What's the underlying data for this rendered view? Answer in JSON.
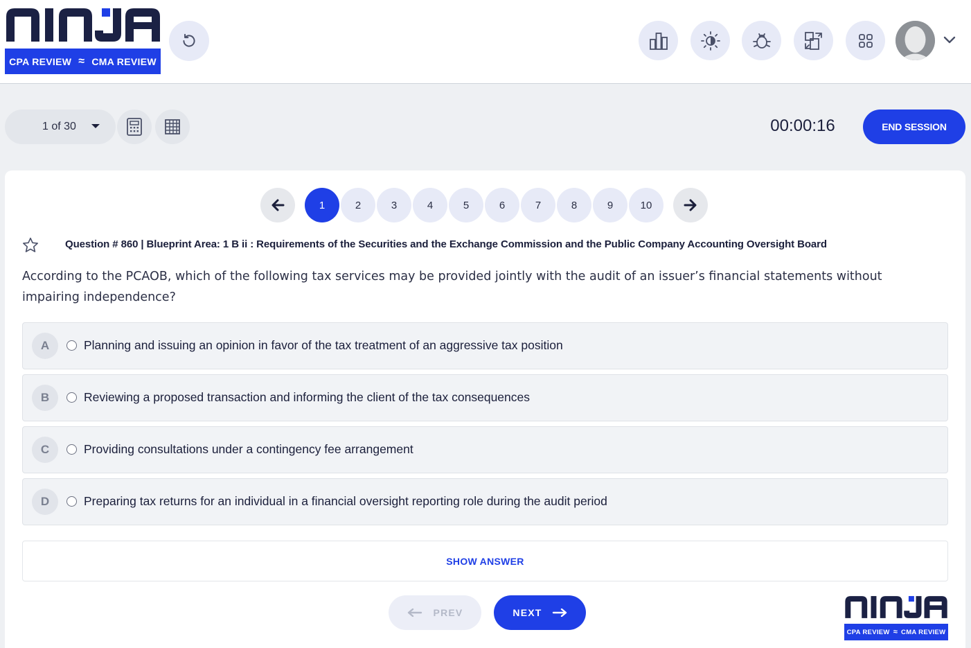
{
  "brand": {
    "logo_text": "NINJA",
    "banner_left": "CPA REVIEW",
    "banner_sep": "≈",
    "banner_right": "CMA REVIEW",
    "accent_color": "#1f3fe6",
    "dark_color": "#1b2144"
  },
  "header": {
    "icons": [
      "refresh-icon",
      "bar-chart-icon",
      "brightness-icon",
      "bug-icon",
      "switch-icon",
      "grid-icon",
      "avatar",
      "chevron-down-icon"
    ]
  },
  "toolbar": {
    "question_select": "1 of 30",
    "timer": "00:00:16",
    "end_session": "END SESSION"
  },
  "pager": {
    "pages": [
      "1",
      "2",
      "3",
      "4",
      "5",
      "6",
      "7",
      "8",
      "9",
      "10"
    ],
    "active": "1"
  },
  "question": {
    "meta": "Question # 860 | Blueprint Area: 1 B ii : Requirements of the Securities and the Exchange Commission and the Public Company Accounting Oversight Board",
    "text": "According to the PCAOB, which of the following tax services may be provided jointly with the audit of an issuer’s financial statements without impairing independence?",
    "options": [
      {
        "letter": "A",
        "text": "Planning and issuing an opinion in favor of the tax treatment of an aggressive tax position"
      },
      {
        "letter": "B",
        "text": "Reviewing a proposed transaction and informing the client of the tax consequences"
      },
      {
        "letter": "C",
        "text": "Providing consultations under a contingency fee arrangement"
      },
      {
        "letter": "D",
        "text": "Preparing tax returns for an individual in a financial oversight reporting role during the audit period"
      }
    ]
  },
  "actions": {
    "show_answer": "SHOW ANSWER",
    "prev": "PREV",
    "next": "NEXT"
  }
}
